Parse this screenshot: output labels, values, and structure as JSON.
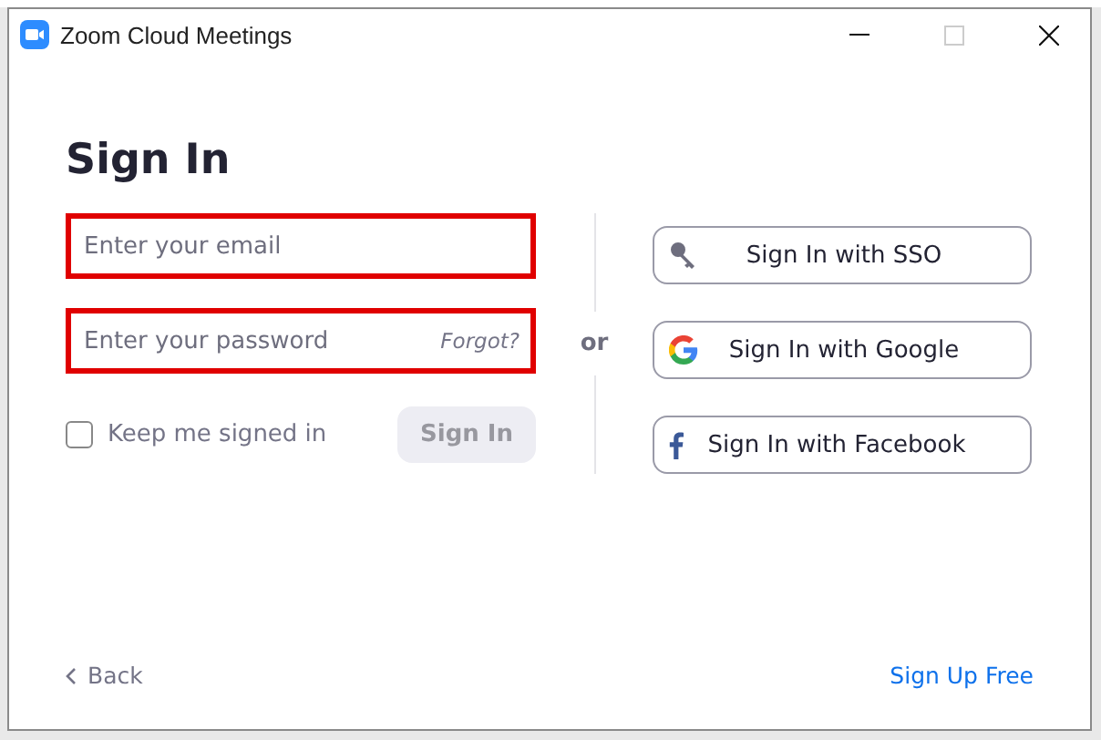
{
  "window": {
    "title": "Zoom Cloud Meetings"
  },
  "heading": "Sign In",
  "email": {
    "placeholder": "Enter your email"
  },
  "password": {
    "placeholder": "Enter your password",
    "forgot": "Forgot?"
  },
  "keep_signed_in": {
    "label": "Keep me signed in",
    "checked": false
  },
  "sign_in_button": {
    "label": "Sign In",
    "disabled": true
  },
  "separator": "or",
  "providers": [
    {
      "kind": "sso",
      "label": "Sign In with SSO"
    },
    {
      "kind": "google",
      "label": "Sign In with Google"
    },
    {
      "kind": "facebook",
      "label": "Sign In with Facebook"
    }
  ],
  "back": "Back",
  "sign_up": "Sign Up Free"
}
